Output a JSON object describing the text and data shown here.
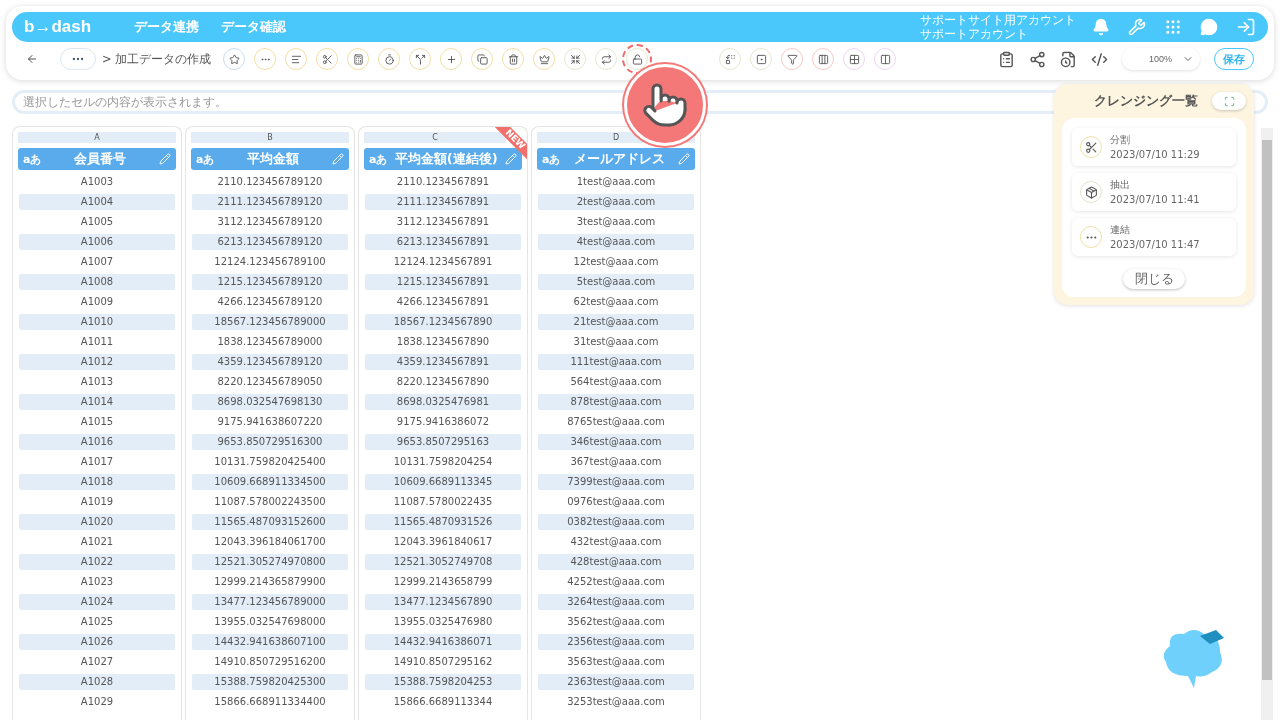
{
  "header": {
    "logo": "b→dash",
    "nav": [
      "データ連携",
      "データ確認"
    ],
    "account": [
      "サポートサイト用アカウント",
      "サポートアカウント"
    ]
  },
  "toolbar": {
    "breadcrumb": "> 加工データの作成",
    "zoom": "100%",
    "save": "保存"
  },
  "cell_viewer": {
    "placeholder": "選択したセルの内容が表示されます。"
  },
  "columns": [
    {
      "letter": "A",
      "type": "aあ",
      "name": "会員番号",
      "cells": [
        "A1003",
        "A1004",
        "A1005",
        "A1006",
        "A1007",
        "A1008",
        "A1009",
        "A1010",
        "A1011",
        "A1012",
        "A1013",
        "A1014",
        "A1015",
        "A1016",
        "A1017",
        "A1018",
        "A1019",
        "A1020",
        "A1021",
        "A1022",
        "A1023",
        "A1024",
        "A1025",
        "A1026",
        "A1027",
        "A1028",
        "A1029"
      ]
    },
    {
      "letter": "B",
      "type": "aあ",
      "name": "平均金額",
      "cells": [
        "2110.123456789120",
        "2111.123456789120",
        "3112.123456789120",
        "6213.123456789120",
        "12124.123456789100",
        "1215.123456789120",
        "4266.123456789120",
        "18567.123456789000",
        "1838.123456789000",
        "4359.123456789120",
        "8220.123456789050",
        "8698.032547698130",
        "9175.941638607220",
        "9653.850729516300",
        "10131.759820425400",
        "10609.668911334500",
        "11087.578002243500",
        "11565.487093152600",
        "12043.396184061700",
        "12521.305274970800",
        "12999.214365879900",
        "13477.123456789000",
        "13955.032547698000",
        "14432.941638607100",
        "14910.850729516200",
        "15388.759820425300",
        "15866.668911334400"
      ]
    },
    {
      "letter": "C",
      "type": "aあ",
      "name": "平均金額(連結後)",
      "badge": "NEW",
      "cells": [
        "2110.1234567891",
        "2111.1234567891",
        "3112.1234567891",
        "6213.1234567891",
        "12124.1234567891",
        "1215.1234567891",
        "4266.1234567891",
        "18567.1234567890",
        "1838.1234567890",
        "4359.1234567891",
        "8220.1234567890",
        "8698.0325476981",
        "9175.9416386072",
        "9653.8507295163",
        "10131.7598204254",
        "10609.6689113345",
        "11087.5780022435",
        "11565.4870931526",
        "12043.3961840617",
        "12521.3052749708",
        "12999.2143658799",
        "13477.1234567890",
        "13955.0325476980",
        "14432.9416386071",
        "14910.8507295162",
        "15388.7598204253",
        "15866.6689113344"
      ]
    },
    {
      "letter": "D",
      "type": "aあ",
      "name": "メールアドレス",
      "cells": [
        "1test@aaa.com",
        "2test@aaa.com",
        "3test@aaa.com",
        "4test@aaa.com",
        "12test@aaa.com",
        "5test@aaa.com",
        "62test@aaa.com",
        "21test@aaa.com",
        "31test@aaa.com",
        "111test@aaa.com",
        "564test@aaa.com",
        "878test@aaa.com",
        "8765test@aaa.com",
        "346test@aaa.com",
        "367test@aaa.com",
        "7399test@aaa.com",
        "0976test@aaa.com",
        "0382test@aaa.com",
        "432test@aaa.com",
        "428test@aaa.com",
        "4252test@aaa.com",
        "3264test@aaa.com",
        "3562test@aaa.com",
        "2356test@aaa.com",
        "3563test@aaa.com",
        "2363test@aaa.com",
        "3253test@aaa.com"
      ]
    }
  ],
  "cleansing_panel": {
    "title": "クレンジング一覧",
    "items": [
      {
        "kind": "split",
        "name": "分割",
        "time": "2023/07/10 11:29"
      },
      {
        "kind": "extract",
        "name": "抽出",
        "time": "2023/07/10 11:41"
      },
      {
        "kind": "concat",
        "name": "連結",
        "time": "2023/07/10 11:47"
      }
    ],
    "close": "閉じる"
  }
}
